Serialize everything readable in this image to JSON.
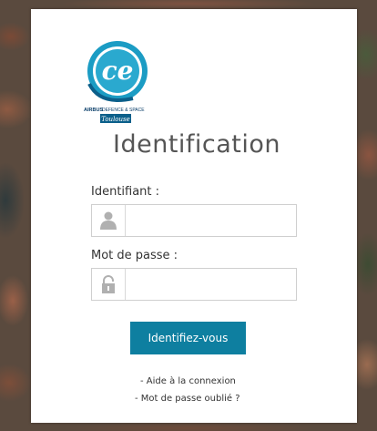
{
  "logo": {
    "brand_text": "ce",
    "company_bold": "AIRBUS",
    "company_light": "DEFENCE & SPACE",
    "city": "Toulouse",
    "colors": {
      "teal": "#1b9cc4",
      "dark_blue": "#0b5f8a"
    }
  },
  "page": {
    "title": "Identification"
  },
  "form": {
    "username_label": "Identifiant :",
    "username_value": "",
    "username_icon": "user-icon",
    "password_label": "Mot de passe :",
    "password_value": "",
    "password_icon": "lock-icon",
    "submit_label": "Identifiez-vous"
  },
  "links": {
    "help": "- Aide à la connexion",
    "forgot_password": "- Mot de passe oublié ?"
  },
  "colors": {
    "button": "#0e7fa0",
    "button_text": "#ffffff",
    "title_text": "#555555",
    "icon_gray": "#b0b0b0"
  }
}
